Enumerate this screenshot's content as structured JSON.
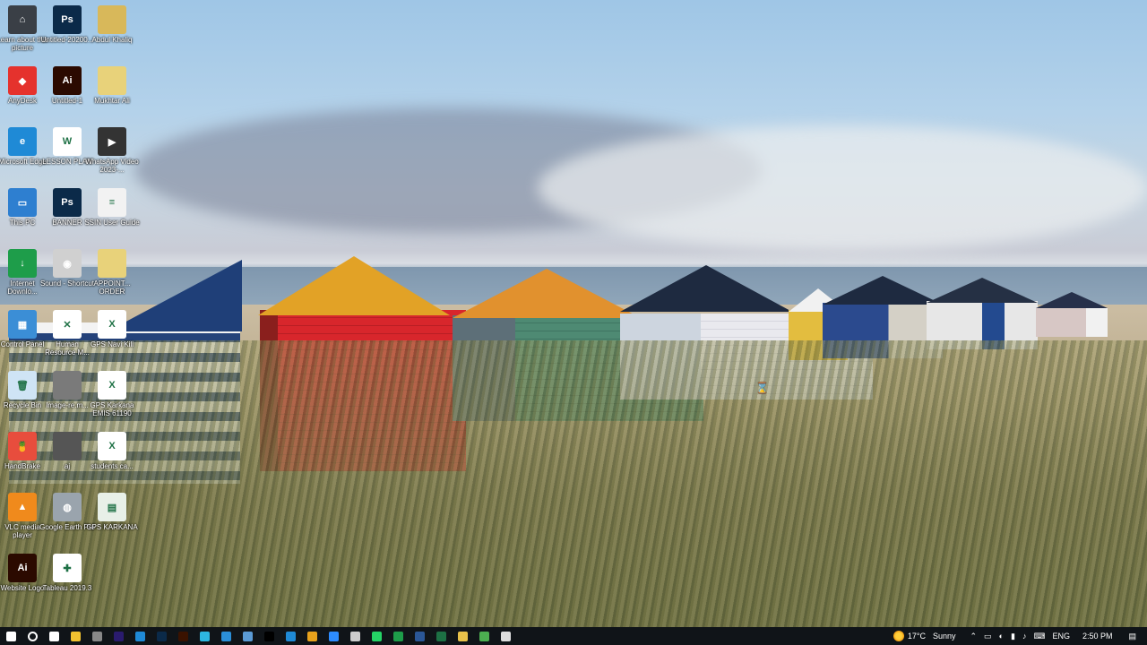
{
  "desktop_icons": [
    {
      "label": "Learn about this picture",
      "color": "#3a3f46",
      "glyph": "⌂"
    },
    {
      "label": "Untitled-20200...",
      "color": "#0b2a49",
      "glyph": "Ps"
    },
    {
      "label": "Abdul Khaliq",
      "color": "#d8b85a",
      "glyph": ""
    },
    {
      "label": "AnyDesk",
      "color": "#e5322d",
      "glyph": "◆"
    },
    {
      "label": "Untitled-1",
      "color": "#2b0a00",
      "glyph": "Ai"
    },
    {
      "label": "Mukhtar Ali",
      "color": "#e8d27a",
      "glyph": ""
    },
    {
      "label": "Microsoft Edge",
      "color": "#1f8ad6",
      "glyph": "e"
    },
    {
      "label": "LESSON PLAN",
      "color": "#ffffff",
      "glyph": "W"
    },
    {
      "label": "WhatsApp Video 2023-...",
      "color": "#333333",
      "glyph": "▶"
    },
    {
      "label": "This PC",
      "color": "#2e7fd0",
      "glyph": "▭"
    },
    {
      "label": "BANNER",
      "color": "#0b2a49",
      "glyph": "Ps"
    },
    {
      "label": "SSIN User Guide",
      "color": "#f2f2f2",
      "glyph": "≡"
    },
    {
      "label": "Internet Downlo...",
      "color": "#1e9d4a",
      "glyph": "↓"
    },
    {
      "label": "Sound - Shortcut",
      "color": "#d0d0d0",
      "glyph": "◉"
    },
    {
      "label": "APPOINT... ORDER",
      "color": "#e8d27a",
      "glyph": ""
    },
    {
      "label": "Control Panel",
      "color": "#3b8ed6",
      "glyph": "▦"
    },
    {
      "label": "Human Resource M...",
      "color": "#ffffff",
      "glyph": "✕"
    },
    {
      "label": "GPS Navi Kili",
      "color": "#ffffff",
      "glyph": "X"
    },
    {
      "label": "Recycle Bin",
      "color": "#cfe4f5",
      "glyph": "🗑"
    },
    {
      "label": "Image-re.m...",
      "color": "#7a7a7a",
      "glyph": ""
    },
    {
      "label": "GPS Karkana EMIS 61190",
      "color": "#ffffff",
      "glyph": "X"
    },
    {
      "label": "HandBrake",
      "color": "#e84d3d",
      "glyph": "🍍"
    },
    {
      "label": "aj",
      "color": "#555555",
      "glyph": ""
    },
    {
      "label": "students ca...",
      "color": "#ffffff",
      "glyph": "X"
    },
    {
      "label": "VLC media player",
      "color": "#f08a1c",
      "glyph": "▲"
    },
    {
      "label": "Google Earth Pro",
      "color": "#9aa4ad",
      "glyph": "◍"
    },
    {
      "label": "GPS KARKANA",
      "color": "#e8f0e8",
      "glyph": "▤"
    },
    {
      "label": "Website Logo",
      "color": "#2b0a00",
      "glyph": "Ai"
    },
    {
      "label": "Tableau 2019.3",
      "color": "#ffffff",
      "glyph": "✚"
    }
  ],
  "taskbar": {
    "apps": [
      {
        "name": "start",
        "color": "#ffffff"
      },
      {
        "name": "search",
        "color": "#ffffff"
      },
      {
        "name": "task-view",
        "color": "#ffffff"
      },
      {
        "name": "app1",
        "color": "#f2c230"
      },
      {
        "name": "app2",
        "color": "#888888"
      },
      {
        "name": "audition",
        "color": "#2a1b6e"
      },
      {
        "name": "edge",
        "color": "#1f8ad6"
      },
      {
        "name": "photoshop",
        "color": "#0b2a49"
      },
      {
        "name": "illustrator",
        "color": "#3a1200"
      },
      {
        "name": "app3",
        "color": "#2db7e0"
      },
      {
        "name": "edge2",
        "color": "#2b8fd8"
      },
      {
        "name": "app4",
        "color": "#5b9bd5"
      },
      {
        "name": "tiktok",
        "color": "#000000"
      },
      {
        "name": "edge3",
        "color": "#1f8ad6"
      },
      {
        "name": "chrome",
        "color": "#e8a21c"
      },
      {
        "name": "zoom",
        "color": "#2d8cff"
      },
      {
        "name": "app5",
        "color": "#cccccc"
      },
      {
        "name": "whatsapp",
        "color": "#25d366"
      },
      {
        "name": "app6",
        "color": "#1e9d4a"
      },
      {
        "name": "word",
        "color": "#2b5797"
      },
      {
        "name": "excel",
        "color": "#1d7044"
      },
      {
        "name": "explorer",
        "color": "#e8c14a"
      },
      {
        "name": "app7",
        "color": "#4caf50"
      },
      {
        "name": "app8",
        "color": "#dddddd"
      }
    ],
    "weather_temp": "17°C",
    "weather_desc": "Sunny",
    "language": "ENG",
    "time": "2:50 PM"
  }
}
